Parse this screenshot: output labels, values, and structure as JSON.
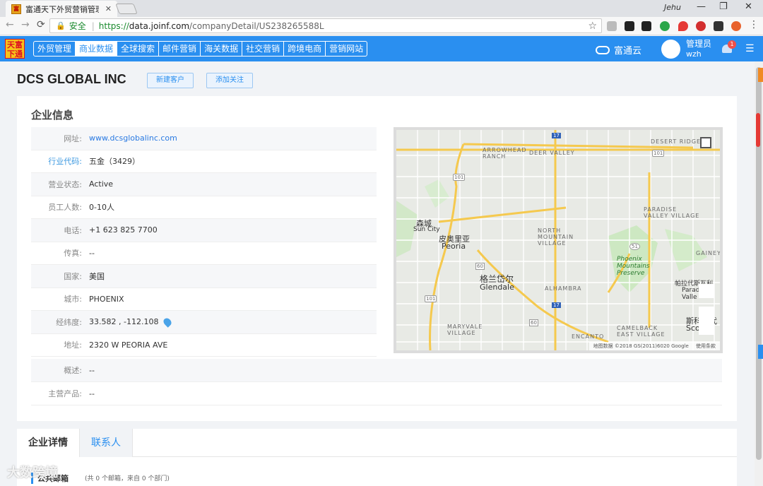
{
  "browser": {
    "tab_title": "富通天下外贸营销管理云",
    "tab_close": "✕",
    "user": "Jehu",
    "secure_label": "安全",
    "url_proto": "https://",
    "url_host": "data.joinf.com",
    "url_path": "/companyDetail/US238265588L",
    "controls": {
      "minimize": "—",
      "maximize": "❐",
      "close": "✕"
    },
    "nav": {
      "back": "←",
      "forward": "→",
      "reload": "⟳"
    },
    "star": "☆"
  },
  "appnav": {
    "logo_text": "天富\n下通",
    "menu": [
      {
        "label": "外贸管理",
        "active": false
      },
      {
        "label": "商业数据",
        "active": true
      },
      {
        "label": "全球搜索",
        "active": false
      },
      {
        "label": "邮件营销",
        "active": false
      },
      {
        "label": "海关数据",
        "active": false
      },
      {
        "label": "社交营销",
        "active": false
      },
      {
        "label": "跨境电商",
        "active": false
      },
      {
        "label": "营销网站",
        "active": false
      }
    ],
    "cloud_label": "富通云",
    "admin_role": "管理员",
    "admin_name": "wzh",
    "notification_count": "1",
    "menu_icon": "☰"
  },
  "page": {
    "company_name": "DCS GLOBAL INC",
    "new_customer_btn": "新建客户",
    "follow_btn": "添加关注"
  },
  "info": {
    "section_title": "企业信息",
    "rows": [
      {
        "label": "网址:",
        "value": "www.dcsglobalinc.com"
      },
      {
        "label": "行业代码:",
        "value": "五金（3429）"
      },
      {
        "label": "营业状态:",
        "value": "Active"
      },
      {
        "label": "员工人数:",
        "value": "0-10人"
      },
      {
        "label": "电话:",
        "value": "+1 623 825 7700"
      },
      {
        "label": "传真:",
        "value": "--"
      },
      {
        "label": "国家:",
        "value": "美国"
      },
      {
        "label": "城市:",
        "value": "PHOENIX"
      },
      {
        "label": "经纬度:",
        "value": "33.582 , -112.108"
      },
      {
        "label": "地址:",
        "value": "2320 W PEORIA AVE"
      }
    ],
    "summary_label": "概述:",
    "summary_value": "--",
    "products_label": "主营产品:",
    "products_value": "--"
  },
  "map": {
    "labels": {
      "arrowhead_ranch": "ARROWHEAD\nRANCH",
      "deer_valley": "DEER VALLEY",
      "desert_ridge": "DESERT RIDGE",
      "sun_city_cn": "森城",
      "sun_city": "Sun City",
      "peoria_cn": "皮奥里亚",
      "peoria": "Peoria",
      "north_mountain": "NORTH\nMOUNTAIN\nVILLAGE",
      "paradise_valley": "PARADISE\nVALLEY VILLAGE",
      "phoenix_mountains": "Phoenix\nMountains\nPreserve",
      "glendale_cn": "格兰岱尔",
      "glendale": "Glendale",
      "alhambra": "ALHAMBRA",
      "maryvale": "MARYVALE\nVILLAGE",
      "encanto": "ENCANTO",
      "camelback": "CAMELBACK\nEAST VILLAGE",
      "gainey": "GAINEY",
      "paradise_valley_cn": "帕拉代斯瓦利",
      "paradise_valley_town": "Parad\nValle",
      "scottsdale_cn": "斯科茨代",
      "scottsdale": "Sco",
      "shield_101_a": "101",
      "shield_101_b": "101",
      "shield_101_c": "101",
      "shield_17_a": "17",
      "shield_17_b": "17",
      "shield_60_a": "60",
      "shield_60_b": "60",
      "shield_51": "51"
    },
    "attribution": "地图数据 ©2018 GS(2011)6020 Google",
    "terms": "使用条款"
  },
  "details": {
    "tab_details": "企业详情",
    "tab_contacts": "联系人",
    "email_heading": "公共邮箱",
    "email_sub": "(共 0 个邮箱，来自 0 个部门)",
    "watermark": "大数跨境"
  }
}
